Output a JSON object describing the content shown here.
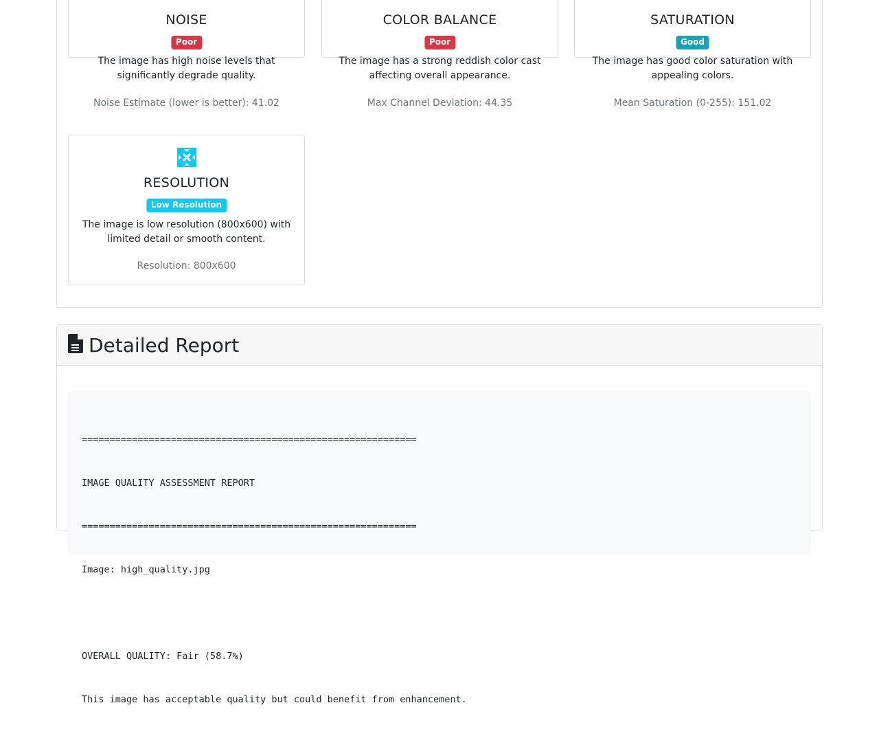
{
  "metrics": {
    "noise": {
      "title": "NOISE",
      "badge": "Poor",
      "description": "The image has high noise levels that significantly degrade quality.",
      "stat": "Noise Estimate (lower is better): 41.02",
      "icon": "broadcast-icon",
      "color": "#dc3545"
    },
    "color_balance": {
      "title": "COLOR BALANCE",
      "badge": "Poor",
      "description": "The image has a strong reddish color cast affecting overall appearance.",
      "stat": "Max Channel Deviation: 44.35",
      "icon": "palette-icon",
      "color": "#dc3545"
    },
    "saturation": {
      "title": "SATURATION",
      "badge": "Good",
      "description": "The image has good color saturation with appealing colors.",
      "stat": "Mean Saturation (0-255): 151.02",
      "icon": "droplet-icon",
      "color": "#17a2b8"
    },
    "resolution": {
      "title": "RESOLUTION",
      "badge": "Low Resolution",
      "description": "The image is low resolution (800x600) with limited detail or smooth content.",
      "stat": "Resolution: 800x600",
      "icon": "expand-arrows-icon",
      "color": "#0dcaf0"
    }
  },
  "report": {
    "title": "Detailed Report",
    "icon": "file-text-icon",
    "lines": [
      "============================================================",
      "IMAGE QUALITY ASSESSMENT REPORT",
      "============================================================",
      "Image: high_quality.jpg",
      "",
      "OVERALL QUALITY: Fair (58.7%)",
      "This image has acceptable quality but could benefit from enhancement."
    ]
  }
}
